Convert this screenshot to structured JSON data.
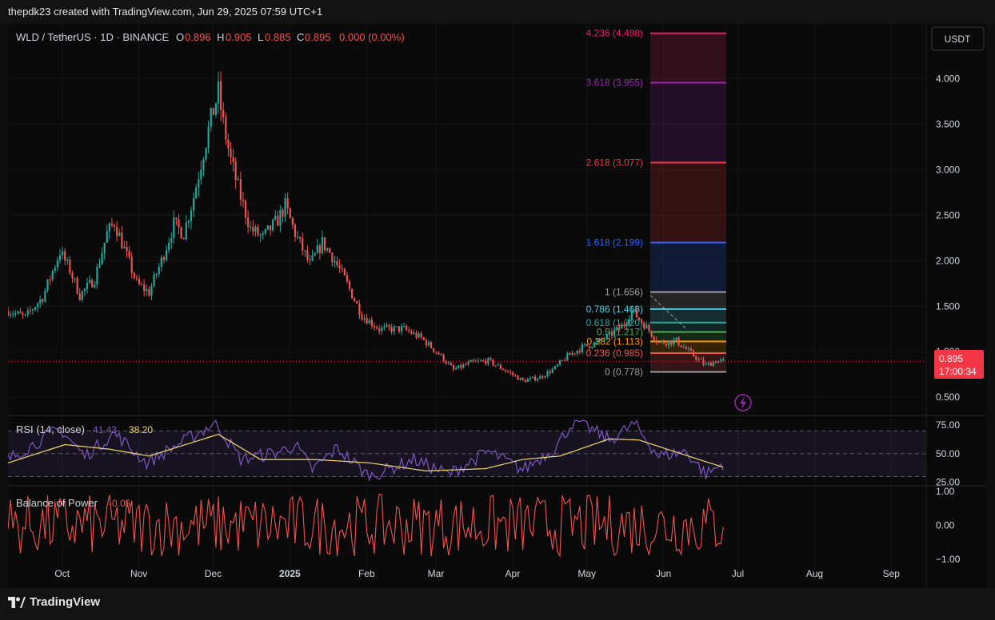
{
  "header": {
    "attribution": "thepdk23 created with TradingView.com, Jun 29, 2025 07:59 UTC+1"
  },
  "legend": {
    "symbol": "WLD / TetherUS · 1D · BINANCE",
    "o_label": "O",
    "o": "0.896",
    "h_label": "H",
    "h": "0.905",
    "l_label": "L",
    "l": "0.885",
    "c_label": "C",
    "c": "0.895",
    "change": "0.000 (0.00%)"
  },
  "currency_button": "USDT",
  "price_badge": {
    "price": "0.895",
    "countdown": "17:00:34"
  },
  "rsi_legend": {
    "label": "RSI (14, close)",
    "v1": "41.43",
    "v2": "38.20"
  },
  "bop_legend": {
    "label": "Balance of Power",
    "v": "-0.05"
  },
  "footer": {
    "brand": "TradingView"
  },
  "colors": {
    "up": "#26a69a",
    "down": "#ef5350",
    "rsi": "#7e57c2",
    "rsi_ma": "#f5d76e",
    "bop": "#ef5350"
  },
  "chart_data": [
    {
      "type": "candlestick",
      "symbol": "WLD/USDT",
      "timeframe": "1D",
      "y_ticks": [
        "4.000",
        "3.500",
        "3.000",
        "2.500",
        "2.000",
        "1.500",
        "1.000",
        "0.500"
      ],
      "ylim": [
        0.3,
        4.6
      ],
      "x_ticks": [
        "Oct",
        "Nov",
        "Dec",
        "2025",
        "Feb",
        "Mar",
        "Apr",
        "May",
        "Jun",
        "Jul",
        "Aug",
        "Sep"
      ],
      "price_path": [
        [
          "2024-09-13",
          1.45
        ],
        [
          "2024-09-20",
          1.38
        ],
        [
          "2024-09-27",
          1.6
        ],
        [
          "2024-10-04",
          2.1
        ],
        [
          "2024-10-08",
          1.9
        ],
        [
          "2024-10-12",
          1.62
        ],
        [
          "2024-10-18",
          1.8
        ],
        [
          "2024-10-23",
          2.3
        ],
        [
          "2024-10-26",
          2.42
        ],
        [
          "2024-10-31",
          2.05
        ],
        [
          "2024-11-04",
          1.75
        ],
        [
          "2024-11-09",
          1.65
        ],
        [
          "2024-11-14",
          2.0
        ],
        [
          "2024-11-19",
          2.4
        ],
        [
          "2024-11-23",
          2.3
        ],
        [
          "2024-11-27",
          2.7
        ],
        [
          "2024-12-01",
          3.2
        ],
        [
          "2024-12-04",
          3.55
        ],
        [
          "2024-12-07",
          3.85
        ],
        [
          "2024-12-09",
          3.5
        ],
        [
          "2024-12-12",
          3.1
        ],
        [
          "2024-12-16",
          2.7
        ],
        [
          "2024-12-20",
          2.35
        ],
        [
          "2024-12-25",
          2.25
        ],
        [
          "2024-12-31",
          2.45
        ],
        [
          "2025-01-03",
          2.6
        ],
        [
          "2025-01-07",
          2.3
        ],
        [
          "2025-01-13",
          1.95
        ],
        [
          "2025-01-18",
          2.2
        ],
        [
          "2025-01-22",
          2.05
        ],
        [
          "2025-01-27",
          1.8
        ],
        [
          "2025-02-03",
          1.4
        ],
        [
          "2025-02-10",
          1.25
        ],
        [
          "2025-02-20",
          1.25
        ],
        [
          "2025-02-27",
          1.15
        ],
        [
          "2025-03-07",
          0.95
        ],
        [
          "2025-03-12",
          0.8
        ],
        [
          "2025-03-19",
          0.88
        ],
        [
          "2025-03-26",
          0.9
        ],
        [
          "2025-04-03",
          0.78
        ],
        [
          "2025-04-09",
          0.68
        ],
        [
          "2025-04-16",
          0.72
        ],
        [
          "2025-04-22",
          0.82
        ],
        [
          "2025-04-27",
          0.95
        ],
        [
          "2025-05-03",
          1.05
        ],
        [
          "2025-05-09",
          1.1
        ],
        [
          "2025-05-14",
          1.18
        ],
        [
          "2025-05-20",
          1.3
        ],
        [
          "2025-05-23",
          1.45
        ],
        [
          "2025-05-28",
          1.3
        ],
        [
          "2025-06-03",
          1.1
        ],
        [
          "2025-06-10",
          1.12
        ],
        [
          "2025-06-16",
          0.98
        ],
        [
          "2025-06-22",
          0.85
        ],
        [
          "2025-06-26",
          0.9
        ],
        [
          "2025-06-29",
          0.895
        ]
      ],
      "current_price": 0.895
    },
    {
      "type": "fibonacci_extension",
      "levels": [
        {
          "label": "0 (0.778)",
          "ratio": 0,
          "price": 0.778,
          "color": "#9e9e9e"
        },
        {
          "label": "0.236 (0.985)",
          "ratio": 0.236,
          "price": 0.985,
          "color": "#ef5350"
        },
        {
          "label": "0.382 (1.113)",
          "ratio": 0.382,
          "price": 1.113,
          "color": "#ff9800"
        },
        {
          "label": "0.5 (1.217)",
          "ratio": 0.5,
          "price": 1.217,
          "color": "#4caf50"
        },
        {
          "label": "0.618 (1.320)",
          "ratio": 0.618,
          "price": 1.32,
          "color": "#26a69a"
        },
        {
          "label": "0.786 (1.468)",
          "ratio": 0.786,
          "price": 1.468,
          "color": "#4dd0e1"
        },
        {
          "label": "1 (1.656)",
          "ratio": 1,
          "price": 1.656,
          "color": "#9e9e9e"
        },
        {
          "label": "1.618 (2.199)",
          "ratio": 1.618,
          "price": 2.199,
          "color": "#2962ff"
        },
        {
          "label": "2.618 (3.077)",
          "ratio": 2.618,
          "price": 3.077,
          "color": "#f23645"
        },
        {
          "label": "3.618 (3.955)",
          "ratio": 3.618,
          "price": 3.955,
          "color": "#9c27b0"
        },
        {
          "label": "4.236 (4.498)",
          "ratio": 4.236,
          "price": 4.498,
          "color": "#e91e63"
        }
      ]
    },
    {
      "type": "line",
      "name": "RSI (14, close)",
      "y_ticks": [
        "75.00",
        "50.00",
        "25.00"
      ],
      "ylim": [
        22,
        80
      ],
      "bands": [
        30,
        50,
        70
      ],
      "rsi_path": [
        [
          "2024-09-13",
          45
        ],
        [
          "2024-10-04",
          72
        ],
        [
          "2024-10-14",
          48
        ],
        [
          "2024-10-26",
          68
        ],
        [
          "2024-11-08",
          42
        ],
        [
          "2024-11-27",
          66
        ],
        [
          "2024-12-06",
          77
        ],
        [
          "2024-12-16",
          45
        ],
        [
          "2025-01-01",
          52
        ],
        [
          "2025-01-07",
          58
        ],
        [
          "2025-01-14",
          36
        ],
        [
          "2025-01-24",
          55
        ],
        [
          "2025-02-06",
          30
        ],
        [
          "2025-02-24",
          45
        ],
        [
          "2025-03-10",
          32
        ],
        [
          "2025-03-26",
          52
        ],
        [
          "2025-04-09",
          36
        ],
        [
          "2025-04-22",
          55
        ],
        [
          "2025-04-30",
          80
        ],
        [
          "2025-05-14",
          62
        ],
        [
          "2025-05-24",
          76
        ],
        [
          "2025-06-03",
          48
        ],
        [
          "2025-06-14",
          52
        ],
        [
          "2025-06-22",
          32
        ],
        [
          "2025-06-29",
          41.43
        ]
      ],
      "rsi_ma_path": [
        [
          "2024-09-13",
          42
        ],
        [
          "2024-10-06",
          58
        ],
        [
          "2024-10-24",
          54
        ],
        [
          "2024-11-09",
          48
        ],
        [
          "2024-12-07",
          67
        ],
        [
          "2024-12-24",
          45
        ],
        [
          "2025-01-15",
          45
        ],
        [
          "2025-02-06",
          42
        ],
        [
          "2025-03-01",
          35
        ],
        [
          "2025-03-25",
          37
        ],
        [
          "2025-04-09",
          45
        ],
        [
          "2025-04-24",
          48
        ],
        [
          "2025-05-14",
          63
        ],
        [
          "2025-05-26",
          62
        ],
        [
          "2025-06-12",
          50
        ],
        [
          "2025-06-29",
          38.2
        ]
      ]
    },
    {
      "type": "line",
      "name": "Balance of Power",
      "y_ticks": [
        "1.00",
        "0.00",
        "−1.00"
      ],
      "ylim": [
        -1.05,
        1.05
      ],
      "last_value": -0.05
    }
  ]
}
